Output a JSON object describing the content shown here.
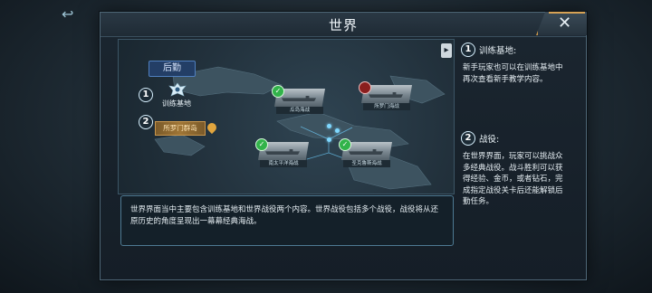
{
  "modal": {
    "title": "世界",
    "close_label": "✕"
  },
  "map": {
    "tab_label": "后勤",
    "training_label": "训练基地",
    "campaign_label": "所罗门群岛",
    "markers": [
      "1",
      "2"
    ],
    "battles": [
      {
        "caption": "瓜岛海战",
        "status": "completed"
      },
      {
        "caption": "所罗门海战",
        "status": "locked"
      },
      {
        "caption": "南太平洋海战",
        "status": "completed"
      },
      {
        "caption": "圣克鲁斯海战",
        "status": "completed"
      }
    ]
  },
  "description": "世界界面当中主要包含训练基地和世界战役两个内容。世界战役包括多个战役，战役将从还原历史的角度呈现出一幕幕经典海战。",
  "sections": [
    {
      "num": "1",
      "title": "训练基地:",
      "body": "新手玩家也可以在训练基地中再次查看新手教学内容。"
    },
    {
      "num": "2",
      "title": "战役:",
      "body": "在世界界面，玩家可以挑战众多经典战役。战斗胜利可以获得经验、金币，或者钻石，完成指定战役关卡后还能解锁后勤任务。"
    }
  ]
}
